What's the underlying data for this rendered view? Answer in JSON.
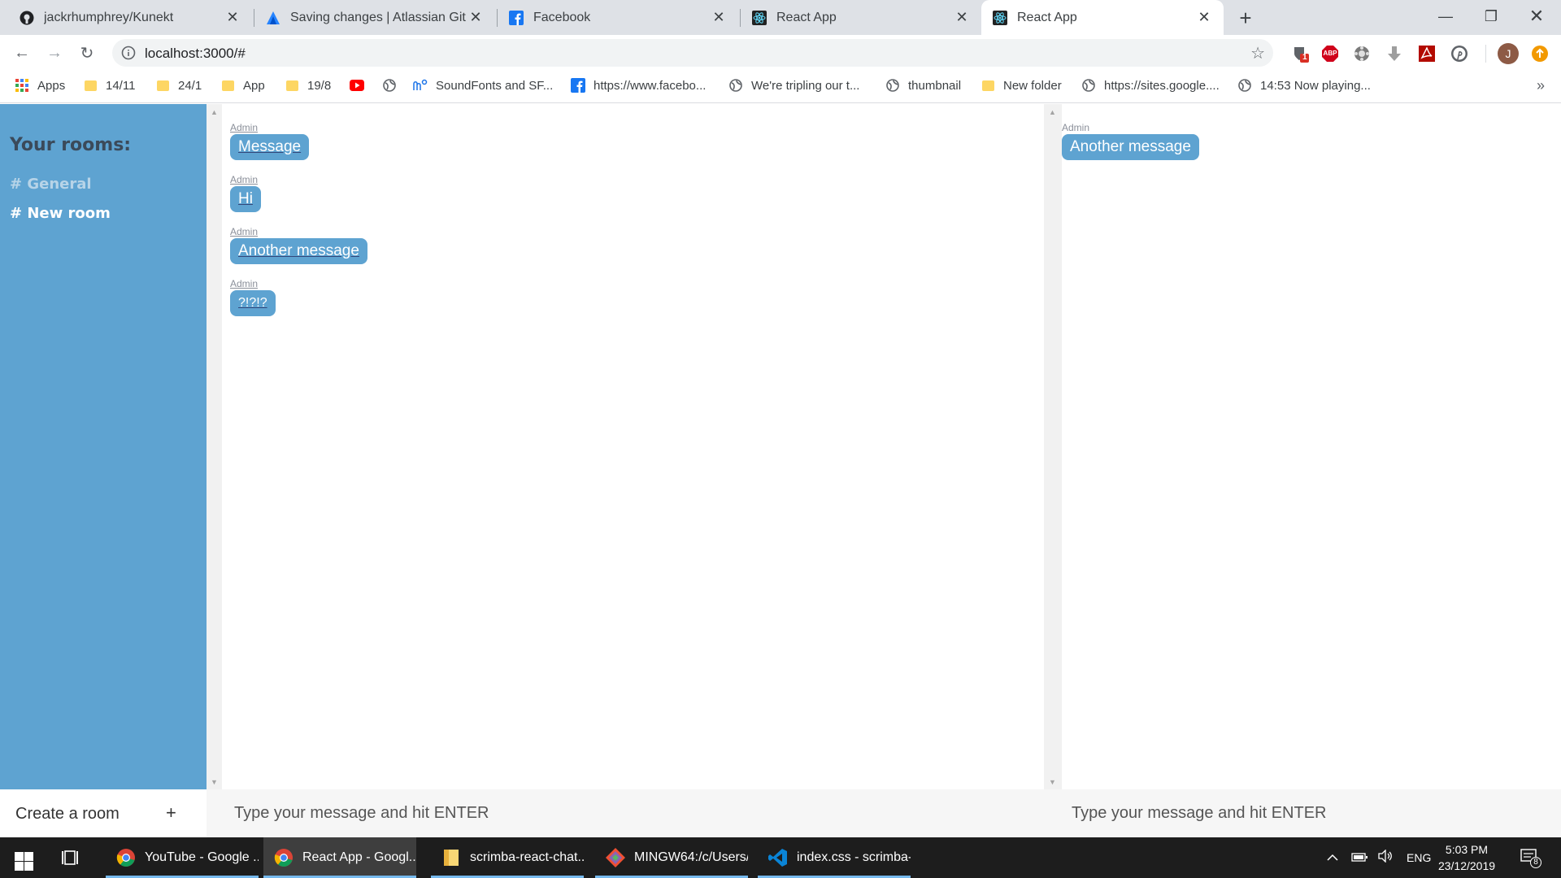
{
  "browser": {
    "tabs": [
      {
        "title": "jackrhumphrey/Kunekt",
        "icon": "github-icon"
      },
      {
        "title": "Saving changes | Atlassian Git Tu",
        "icon": "atlassian-icon"
      },
      {
        "title": "Facebook",
        "icon": "facebook-icon"
      },
      {
        "title": "React App",
        "icon": "react-icon"
      },
      {
        "title": "React App",
        "icon": "react-icon",
        "active": true
      }
    ],
    "close_glyph": "✕",
    "new_tab_glyph": "+",
    "window_controls": {
      "minimize": "—",
      "restore": "❐",
      "close": "✕"
    },
    "nav": {
      "back": "←",
      "forward": "→",
      "reload": "↻"
    },
    "url": "localhost:3000/#",
    "star_glyph": "☆",
    "extensions": [
      "shield-icon",
      "adblock-icon",
      "extension-icon",
      "download-icon",
      "pdf-icon",
      "pinterest-icon"
    ],
    "profile_initial": "J",
    "shield_badge": "1",
    "abp_label": "ABP",
    "bookmarks": [
      {
        "label": "Apps",
        "icon": "apps-grid-icon"
      },
      {
        "label": "14/11",
        "icon": "folder-icon"
      },
      {
        "label": "24/1",
        "icon": "folder-icon"
      },
      {
        "label": "App",
        "icon": "folder-icon"
      },
      {
        "label": "19/8",
        "icon": "folder-icon"
      },
      {
        "label": "",
        "icon": "youtube-icon"
      },
      {
        "label": "",
        "icon": "globe-icon"
      },
      {
        "label": "SoundFonts and SF...",
        "icon": "musescore-icon"
      },
      {
        "label": "https://www.facebo...",
        "icon": "facebook-icon"
      },
      {
        "label": "We're tripling our t...",
        "icon": "globe-icon"
      },
      {
        "label": "thumbnail",
        "icon": "globe-icon"
      },
      {
        "label": "New folder",
        "icon": "folder-icon"
      },
      {
        "label": "https://sites.google....",
        "icon": "globe-icon"
      },
      {
        "label": "14:53 Now playing...",
        "icon": "globe-icon"
      }
    ],
    "bookmarks_more": "»"
  },
  "app": {
    "sidebar": {
      "heading": "Your rooms:",
      "rooms": [
        {
          "label": "# General",
          "active": false
        },
        {
          "label": "# New room",
          "active": true
        }
      ]
    },
    "left_pane": {
      "messages": [
        {
          "user": "Admin",
          "text": "Message"
        },
        {
          "user": "Admin",
          "text": "Hi"
        },
        {
          "user": "Admin",
          "text": "Another message"
        },
        {
          "user": "Admin",
          "text": "?!?!?"
        }
      ]
    },
    "right_pane": {
      "messages": [
        {
          "user": "Admin",
          "text": "Another message"
        }
      ]
    },
    "create_room": {
      "label": "Create a room",
      "plus": "+"
    },
    "message_input_left": {
      "placeholder": "Type your message and hit ENTER"
    },
    "message_input_right": {
      "placeholder": "Type your message and hit ENTER"
    }
  },
  "taskbar": {
    "apps": [
      {
        "label": "YouTube - Google ...",
        "icon": "chrome-icon",
        "active": false
      },
      {
        "label": "React App - Googl...",
        "icon": "chrome-icon",
        "active": true
      },
      {
        "label": "scrimba-react-chat...",
        "icon": "folder-icon",
        "active": false
      },
      {
        "label": "MINGW64:/c/Users/...",
        "icon": "git-icon",
        "active": false
      },
      {
        "label": "index.css - scrimba-...",
        "icon": "vscode-icon",
        "active": false
      }
    ],
    "tray": {
      "language": "ENG",
      "time": "5:03 PM",
      "date": "23/12/2019",
      "notifications": "8"
    }
  }
}
